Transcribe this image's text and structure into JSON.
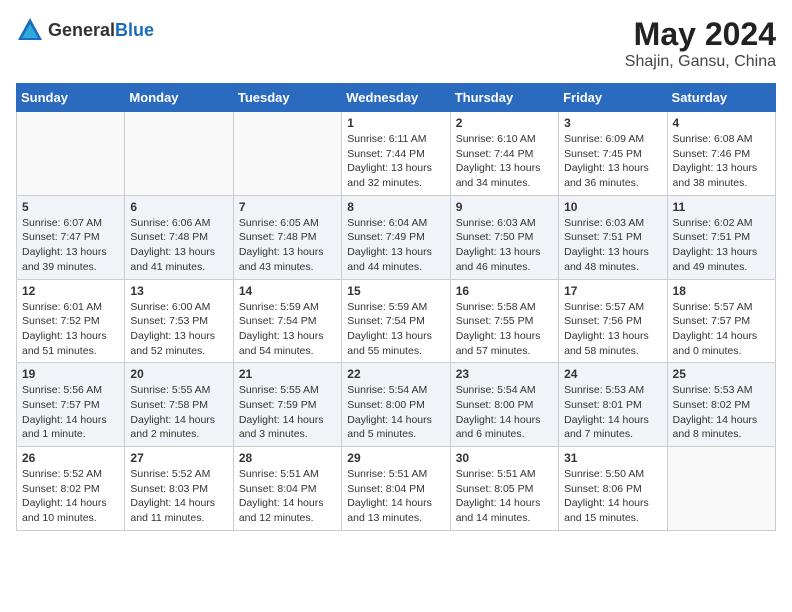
{
  "header": {
    "logo_general": "General",
    "logo_blue": "Blue",
    "month_year": "May 2024",
    "location": "Shajin, Gansu, China"
  },
  "weekdays": [
    "Sunday",
    "Monday",
    "Tuesday",
    "Wednesday",
    "Thursday",
    "Friday",
    "Saturday"
  ],
  "rows": [
    [
      {
        "day": "",
        "empty": true
      },
      {
        "day": "",
        "empty": true
      },
      {
        "day": "",
        "empty": true
      },
      {
        "day": "1",
        "sunrise": "6:11 AM",
        "sunset": "7:44 PM",
        "daylight": "13 hours and 32 minutes."
      },
      {
        "day": "2",
        "sunrise": "6:10 AM",
        "sunset": "7:44 PM",
        "daylight": "13 hours and 34 minutes."
      },
      {
        "day": "3",
        "sunrise": "6:09 AM",
        "sunset": "7:45 PM",
        "daylight": "13 hours and 36 minutes."
      },
      {
        "day": "4",
        "sunrise": "6:08 AM",
        "sunset": "7:46 PM",
        "daylight": "13 hours and 38 minutes."
      }
    ],
    [
      {
        "day": "5",
        "sunrise": "6:07 AM",
        "sunset": "7:47 PM",
        "daylight": "13 hours and 39 minutes."
      },
      {
        "day": "6",
        "sunrise": "6:06 AM",
        "sunset": "7:48 PM",
        "daylight": "13 hours and 41 minutes."
      },
      {
        "day": "7",
        "sunrise": "6:05 AM",
        "sunset": "7:48 PM",
        "daylight": "13 hours and 43 minutes."
      },
      {
        "day": "8",
        "sunrise": "6:04 AM",
        "sunset": "7:49 PM",
        "daylight": "13 hours and 44 minutes."
      },
      {
        "day": "9",
        "sunrise": "6:03 AM",
        "sunset": "7:50 PM",
        "daylight": "13 hours and 46 minutes."
      },
      {
        "day": "10",
        "sunrise": "6:03 AM",
        "sunset": "7:51 PM",
        "daylight": "13 hours and 48 minutes."
      },
      {
        "day": "11",
        "sunrise": "6:02 AM",
        "sunset": "7:51 PM",
        "daylight": "13 hours and 49 minutes."
      }
    ],
    [
      {
        "day": "12",
        "sunrise": "6:01 AM",
        "sunset": "7:52 PM",
        "daylight": "13 hours and 51 minutes."
      },
      {
        "day": "13",
        "sunrise": "6:00 AM",
        "sunset": "7:53 PM",
        "daylight": "13 hours and 52 minutes."
      },
      {
        "day": "14",
        "sunrise": "5:59 AM",
        "sunset": "7:54 PM",
        "daylight": "13 hours and 54 minutes."
      },
      {
        "day": "15",
        "sunrise": "5:59 AM",
        "sunset": "7:54 PM",
        "daylight": "13 hours and 55 minutes."
      },
      {
        "day": "16",
        "sunrise": "5:58 AM",
        "sunset": "7:55 PM",
        "daylight": "13 hours and 57 minutes."
      },
      {
        "day": "17",
        "sunrise": "5:57 AM",
        "sunset": "7:56 PM",
        "daylight": "13 hours and 58 minutes."
      },
      {
        "day": "18",
        "sunrise": "5:57 AM",
        "sunset": "7:57 PM",
        "daylight": "14 hours and 0 minutes."
      }
    ],
    [
      {
        "day": "19",
        "sunrise": "5:56 AM",
        "sunset": "7:57 PM",
        "daylight": "14 hours and 1 minute."
      },
      {
        "day": "20",
        "sunrise": "5:55 AM",
        "sunset": "7:58 PM",
        "daylight": "14 hours and 2 minutes."
      },
      {
        "day": "21",
        "sunrise": "5:55 AM",
        "sunset": "7:59 PM",
        "daylight": "14 hours and 3 minutes."
      },
      {
        "day": "22",
        "sunrise": "5:54 AM",
        "sunset": "8:00 PM",
        "daylight": "14 hours and 5 minutes."
      },
      {
        "day": "23",
        "sunrise": "5:54 AM",
        "sunset": "8:00 PM",
        "daylight": "14 hours and 6 minutes."
      },
      {
        "day": "24",
        "sunrise": "5:53 AM",
        "sunset": "8:01 PM",
        "daylight": "14 hours and 7 minutes."
      },
      {
        "day": "25",
        "sunrise": "5:53 AM",
        "sunset": "8:02 PM",
        "daylight": "14 hours and 8 minutes."
      }
    ],
    [
      {
        "day": "26",
        "sunrise": "5:52 AM",
        "sunset": "8:02 PM",
        "daylight": "14 hours and 10 minutes."
      },
      {
        "day": "27",
        "sunrise": "5:52 AM",
        "sunset": "8:03 PM",
        "daylight": "14 hours and 11 minutes."
      },
      {
        "day": "28",
        "sunrise": "5:51 AM",
        "sunset": "8:04 PM",
        "daylight": "14 hours and 12 minutes."
      },
      {
        "day": "29",
        "sunrise": "5:51 AM",
        "sunset": "8:04 PM",
        "daylight": "14 hours and 13 minutes."
      },
      {
        "day": "30",
        "sunrise": "5:51 AM",
        "sunset": "8:05 PM",
        "daylight": "14 hours and 14 minutes."
      },
      {
        "day": "31",
        "sunrise": "5:50 AM",
        "sunset": "8:06 PM",
        "daylight": "14 hours and 15 minutes."
      },
      {
        "day": "",
        "empty": true
      }
    ]
  ]
}
